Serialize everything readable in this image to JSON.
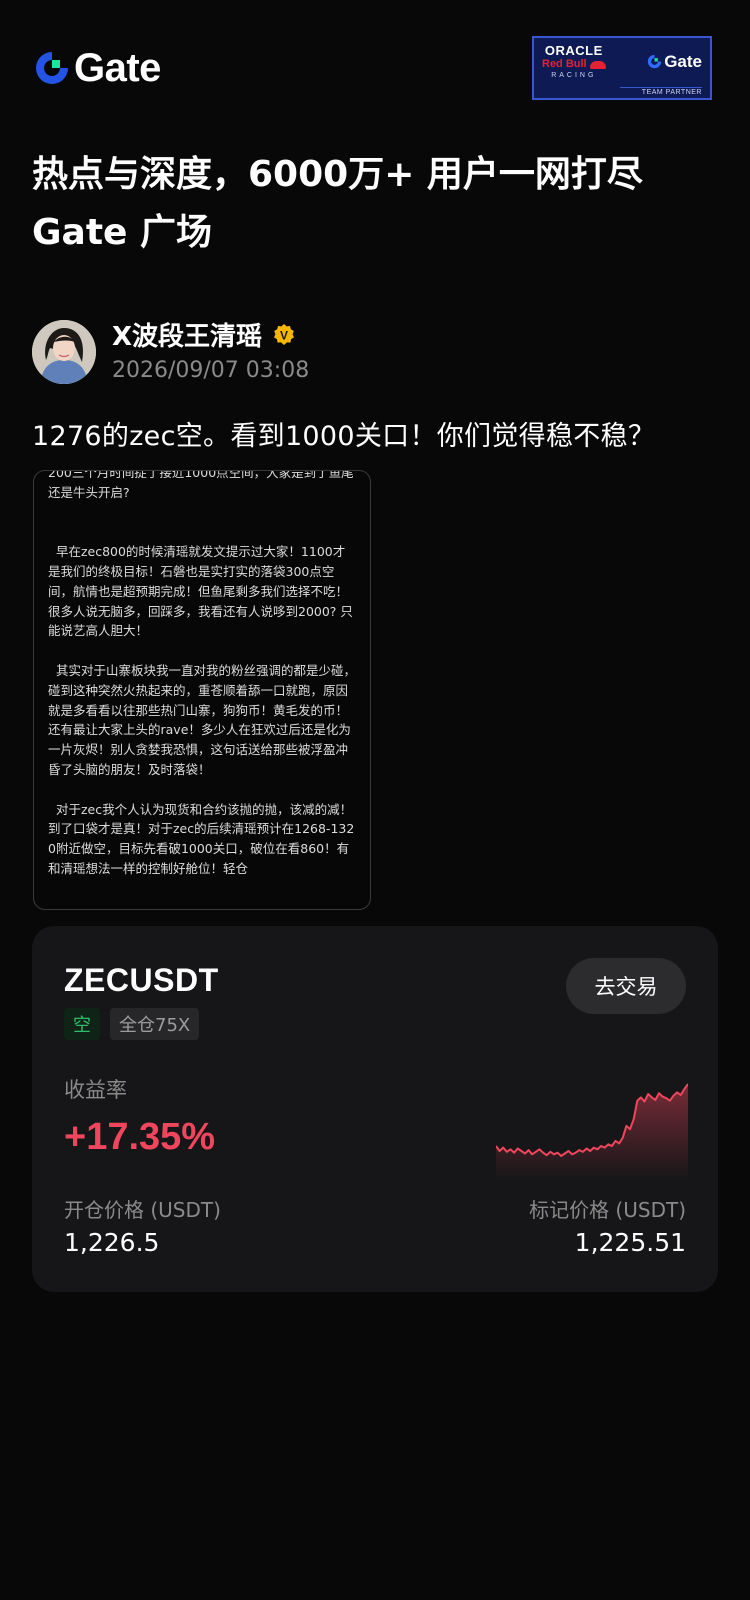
{
  "brand": {
    "name": "Gate",
    "accent": "#2354e6",
    "accent_green": "#17e6a1"
  },
  "partner_badge": {
    "oracle": "ORACLE",
    "red_bull": "Red Bull",
    "racing": "RACING",
    "gate": "Gate",
    "subtitle": "TEAM PARTNER"
  },
  "headline": {
    "line1": "热点与深度，6000万+ 用户一网打尽",
    "line2": "Gate 广场"
  },
  "post": {
    "author": "X波段王清瑶",
    "verified_badge": "V",
    "time": "2026/09/07 03:08",
    "text": "1276的zec空。看到1000关口！你们觉得稳不稳？",
    "image_text": "200三个月时间捉了接近1000点空间，大家是到了鱼尾还是牛头开启?\n\n\n  早在zec800的时候清瑶就发文提示过大家！1100才是我们的终极目标！石磐也是实打实的落袋300点空间，航情也是超预期完成！但鱼尾剩多我们选择不吃！很多人说无脑多，回踩多，我看还有人说哆到2000? 只能说艺高人胆大！\n\n  其实对于山寨板块我一直对我的粉丝强调的都是少碰，碰到这种突然火热起来的，重苍顺着舔一口就跑，原因就是多看看以往那些热门山寨，狗狗币！黄毛发的币！还有最让大家上头的rave！多少人在狂欢过后还是化为一片灰烬！别人贪婪我恐惧，这句话送给那些被浮盈冲昏了头脑的朋友！及时落袋！\n\n  对于zec我个人认为现货和合约该抛的抛，该减的减！到了口袋才是真！对于zec的后续清瑶预计在1268-1320附近做空，目标先看破1000关口，破位在看860！有和清瑶想法一样的控制好舱位！轻仓"
  },
  "trade_card": {
    "pair": "ZECUSDT",
    "trade_button": "去交易",
    "tag_direction": "空",
    "tag_leverage": "全仓75X",
    "yield_label": "收益率",
    "yield_value": "+17.35%",
    "open_price_label": "开仓价格 (USDT)",
    "open_price": "1,226.5",
    "mark_price_label": "标记价格 (USDT)",
    "mark_price": "1,225.51",
    "profit_color": "#f0465d",
    "short_color": "#2ebd6b",
    "sparkline_values": [
      1226,
      1220,
      1224,
      1219,
      1222,
      1218,
      1223,
      1220,
      1217,
      1221,
      1216,
      1219,
      1222,
      1218,
      1215,
      1219,
      1216,
      1218,
      1214,
      1217,
      1220,
      1216,
      1218,
      1221,
      1219,
      1223,
      1220,
      1224,
      1222,
      1226,
      1224,
      1228,
      1226,
      1232,
      1229,
      1236,
      1250,
      1246,
      1258,
      1280,
      1284,
      1279,
      1288,
      1284,
      1281,
      1289,
      1285,
      1283,
      1280,
      1286,
      1290,
      1287,
      1294,
      1300
    ]
  }
}
